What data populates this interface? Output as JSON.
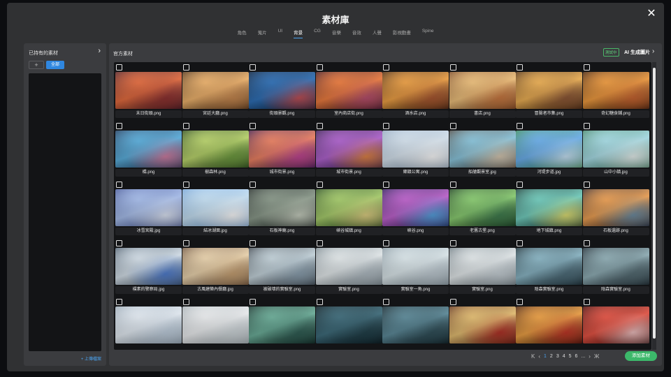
{
  "modal": {
    "title": "素材庫",
    "close": "✕",
    "tabs": [
      {
        "label": "角色",
        "active": false
      },
      {
        "label": "蒐片",
        "active": false
      },
      {
        "label": "UI",
        "active": false
      },
      {
        "label": "背景",
        "active": true
      },
      {
        "label": "CG",
        "active": false
      },
      {
        "label": "音樂",
        "active": false
      },
      {
        "label": "音效",
        "active": false
      },
      {
        "label": "人聲",
        "active": false
      },
      {
        "label": "影視動畫",
        "active": false
      },
      {
        "label": "Spine",
        "active": false
      }
    ]
  },
  "left": {
    "header": "已持有的素材",
    "chevron": "›",
    "add": "+",
    "all": "全部",
    "upload": "+ 上傳檔案"
  },
  "right": {
    "header": "官方素材",
    "badge": "測試中",
    "ai": "AI 生成圖片",
    "chevron": "›"
  },
  "assets": [
    {
      "name": "末日街頭.png",
      "c1": "#e7693a",
      "c2": "#3a1a28",
      "c3": "#8c2b2b"
    },
    {
      "name": "宮廷大廳.png",
      "c1": "#f2b46a",
      "c2": "#3a2212",
      "c3": "#c7854a"
    },
    {
      "name": "街頭景觀.png",
      "c1": "#2a6eb8",
      "c2": "#0f1a2c",
      "c3": "#c04a50"
    },
    {
      "name": "室內商店街.png",
      "c1": "#f07a3a",
      "c2": "#2a1024",
      "c3": "#b84a6a"
    },
    {
      "name": "酒水店.png",
      "c1": "#f1a040",
      "c2": "#2e1a10",
      "c3": "#a8522a"
    },
    {
      "name": "書店.png",
      "c1": "#f2c27a",
      "c2": "#6a3a1e",
      "c3": "#c9743a"
    },
    {
      "name": "冒險者市集.png",
      "c1": "#f0b050",
      "c2": "#3a2010",
      "c3": "#8a5230"
    },
    {
      "name": "奇幻糖食鋪.png",
      "c1": "#f29a3a",
      "c2": "#2a140c",
      "c3": "#c9602a"
    },
    {
      "name": "橋.png",
      "c1": "#58b0e0",
      "c2": "#1c2a48",
      "c3": "#d07aa0"
    },
    {
      "name": "樹森林.png",
      "c1": "#bcd86a",
      "c2": "#1e3a1a",
      "c3": "#6a9a3a"
    },
    {
      "name": "城市街景.png",
      "c1": "#f08060",
      "c2": "#2a1650",
      "c3": "#c04090"
    },
    {
      "name": "城市街景.png",
      "c1": "#b060d0",
      "c2": "#2a1a40",
      "c3": "#e08040"
    },
    {
      "name": "鄉鎮公寓.png",
      "c1": "#d8e6f2",
      "c2": "#8aa0b8",
      "c3": "#ffffff"
    },
    {
      "name": "船艙觀景室.jpg",
      "c1": "#8ac8e0",
      "c2": "#4a3a30",
      "c3": "#d8c8b0"
    },
    {
      "name": "河堤步道.jpg",
      "c1": "#6ab0f0",
      "c2": "#3a8a4a",
      "c3": "#c8e4f8"
    },
    {
      "name": "山中小鎮.jpg",
      "c1": "#a8e0ea",
      "c2": "#3a7a5a",
      "c3": "#e8f2f0"
    },
    {
      "name": "冰雪宮殿.jpg",
      "c1": "#a8c0f0",
      "c2": "#3a4a8a",
      "c3": "#e0e8f8"
    },
    {
      "name": "結冰湖面.jpg",
      "c1": "#c8e4f8",
      "c2": "#6a9ad0",
      "c3": "#ffffff"
    },
    {
      "name": "石板神廟.png",
      "c1": "#8a9a8a",
      "c2": "#1a2020",
      "c3": "#c8d0c0"
    },
    {
      "name": "峽谷城鎮.png",
      "c1": "#a8d06a",
      "c2": "#1a3a1a",
      "c3": "#e0d080"
    },
    {
      "name": "峽谷.png",
      "c1": "#c060d0",
      "c2": "#1a1a4a",
      "c3": "#50a0e0"
    },
    {
      "name": "老舊古堡.png",
      "c1": "#8ad070",
      "c2": "#102a18",
      "c3": "#3a7a4a"
    },
    {
      "name": "地下城鎮.png",
      "c1": "#70d0c0",
      "c2": "#102420",
      "c3": "#e0e070"
    },
    {
      "name": "石板遺跡.png",
      "c1": "#f0a050",
      "c2": "#1a1a2a",
      "c3": "#6a8aa0"
    },
    {
      "name": "樸素的警察局.jpg",
      "c1": "#d8e4ee",
      "c2": "#3a4a5a",
      "c3": "#4a7ad0"
    },
    {
      "name": "古風建築內餐廳.jpg",
      "c1": "#f0d8b0",
      "c2": "#5a4030",
      "c3": "#c8a070"
    },
    {
      "name": "被破壞的實驗室.png",
      "c1": "#c8d8e0",
      "c2": "#2a3038",
      "c3": "#8aa0b0"
    },
    {
      "name": "實驗室.png",
      "c1": "#e8eef0",
      "c2": "#6a7880",
      "c3": "#b0bcc4"
    },
    {
      "name": "實驗室一角.png",
      "c1": "#e0ecf0",
      "c2": "#7a8a94",
      "c3": "#c0ccd4"
    },
    {
      "name": "實驗室.png",
      "c1": "#e8eef0",
      "c2": "#5a6870",
      "c3": "#c8d2d8"
    },
    {
      "name": "陰森實驗室.png",
      "c1": "#8ab8c8",
      "c2": "#0e1a20",
      "c3": "#4a6a78"
    },
    {
      "name": "陰森實驗室.png",
      "c1": "#90b0b8",
      "c2": "#101820",
      "c3": "#506870"
    },
    {
      "name": "",
      "c1": "#e8f0f8",
      "c2": "#8a9aa8",
      "c3": "#c0d0e0"
    },
    {
      "name": "",
      "c1": "#f0f2f4",
      "c2": "#9aa4aa",
      "c3": "#d0d8dc"
    },
    {
      "name": "",
      "c1": "#6ab09a",
      "c2": "#0a1a18",
      "c3": "#2a5a50"
    },
    {
      "name": "",
      "c1": "#3a6a7a",
      "c2": "#081014",
      "c3": "#1a3a44"
    },
    {
      "name": "",
      "c1": "#5a8a9a",
      "c2": "#0a1418",
      "c3": "#2a4a54"
    },
    {
      "name": "",
      "c1": "#e8c070",
      "c2": "#4a1a10",
      "c3": "#b02a20"
    },
    {
      "name": "",
      "c1": "#f0a040",
      "c2": "#2a0c08",
      "c3": "#c03020"
    },
    {
      "name": "",
      "c1": "#e85040",
      "c2": "#2a0808",
      "c3": "#f0c0c0"
    }
  ],
  "pagination": {
    "first": "K",
    "prev": "‹",
    "pages": [
      "1",
      "2",
      "3",
      "4",
      "5",
      "6",
      "..."
    ],
    "current": "1",
    "next": "›",
    "last": "Ж"
  },
  "add_material": "添加素材"
}
